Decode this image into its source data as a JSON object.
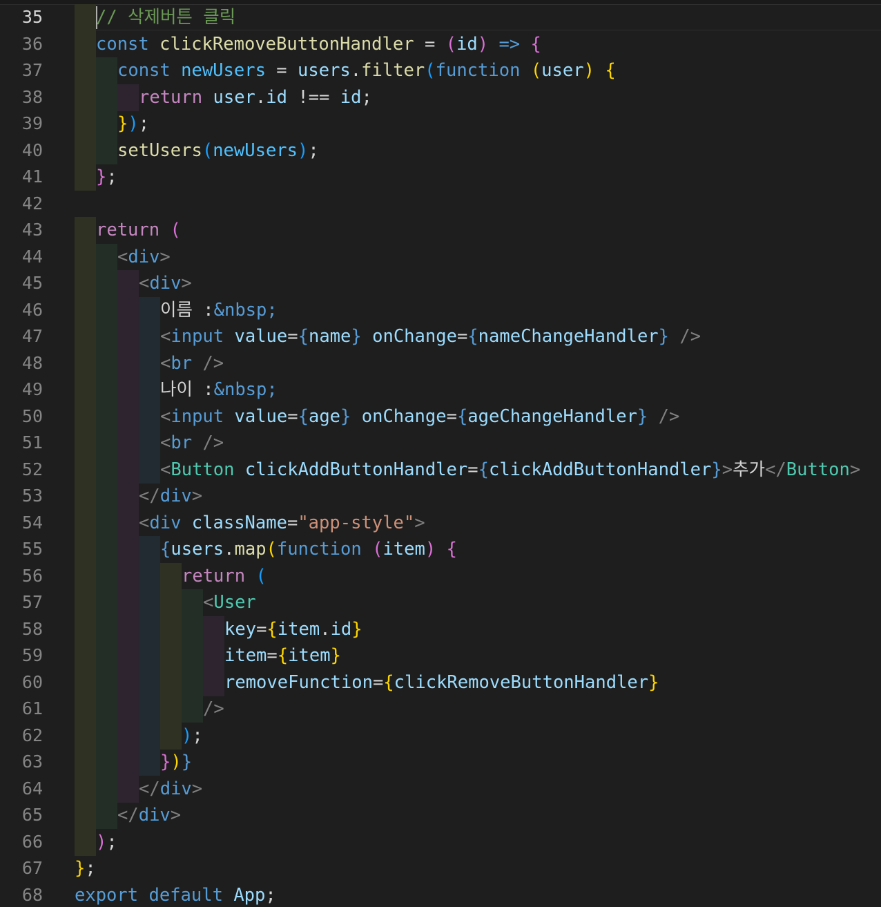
{
  "editor": {
    "language": "javascript-react",
    "active_line": 35,
    "colors": {
      "background": "#1e1e1e",
      "keyword": "#569cd6",
      "control": "#c586c0",
      "function": "#dcdcaa",
      "variable": "#9cdcfe",
      "comment": "#6a9955",
      "string": "#ce9178",
      "component": "#4ec9b0",
      "bracket_1": "#ffd700",
      "bracket_2": "#da70d6",
      "bracket_3": "#179fff"
    }
  },
  "line_numbers": [
    "35",
    "36",
    "37",
    "38",
    "39",
    "40",
    "41",
    "42",
    "43",
    "44",
    "45",
    "46",
    "47",
    "48",
    "49",
    "50",
    "51",
    "52",
    "53",
    "54",
    "55",
    "56",
    "57",
    "58",
    "59",
    "60",
    "61",
    "62",
    "63",
    "64",
    "65",
    "66",
    "67",
    "68"
  ],
  "code": [
    [
      [
        "cm",
        "// 삭제버튼 클릭"
      ]
    ],
    [
      [
        "kw",
        "const"
      ],
      [
        "txt",
        " "
      ],
      [
        "fn",
        "clickRemoveButtonHandler"
      ],
      [
        "txt",
        " = "
      ],
      [
        "b2",
        "("
      ],
      [
        "var",
        "id"
      ],
      [
        "b2",
        ")"
      ],
      [
        "txt",
        " "
      ],
      [
        "kw",
        "=>"
      ],
      [
        "txt",
        " "
      ],
      [
        "b2",
        "{"
      ]
    ],
    [
      [
        "kw",
        "const"
      ],
      [
        "txt",
        " "
      ],
      [
        "const",
        "newUsers"
      ],
      [
        "txt",
        " = "
      ],
      [
        "var",
        "users"
      ],
      [
        "txt",
        "."
      ],
      [
        "fn",
        "filter"
      ],
      [
        "b3",
        "("
      ],
      [
        "kw",
        "function"
      ],
      [
        "txt",
        " "
      ],
      [
        "b1",
        "("
      ],
      [
        "var",
        "user"
      ],
      [
        "b1",
        ")"
      ],
      [
        "txt",
        " "
      ],
      [
        "b1",
        "{"
      ]
    ],
    [
      [
        "ctl",
        "return"
      ],
      [
        "txt",
        " "
      ],
      [
        "var",
        "user"
      ],
      [
        "txt",
        "."
      ],
      [
        "var",
        "id"
      ],
      [
        "txt",
        " !== "
      ],
      [
        "var",
        "id"
      ],
      [
        "txt",
        ";"
      ]
    ],
    [
      [
        "b1",
        "}"
      ],
      [
        "b3",
        ")"
      ],
      [
        "txt",
        ";"
      ]
    ],
    [
      [
        "fn",
        "setUsers"
      ],
      [
        "b3",
        "("
      ],
      [
        "const",
        "newUsers"
      ],
      [
        "b3",
        ")"
      ],
      [
        "txt",
        ";"
      ]
    ],
    [
      [
        "b2",
        "}"
      ],
      [
        "txt",
        ";"
      ]
    ],
    [],
    [
      [
        "ctl",
        "return"
      ],
      [
        "txt",
        " "
      ],
      [
        "b2",
        "("
      ]
    ],
    [
      [
        "punct",
        "<"
      ],
      [
        "tag",
        "div"
      ],
      [
        "punct",
        ">"
      ]
    ],
    [
      [
        "punct",
        "<"
      ],
      [
        "tag",
        "div"
      ],
      [
        "punct",
        ">"
      ]
    ],
    [
      [
        "txt",
        "이름 :"
      ],
      [
        "ent",
        "&nbsp;"
      ]
    ],
    [
      [
        "punct",
        "<"
      ],
      [
        "tag",
        "input"
      ],
      [
        "txt",
        " "
      ],
      [
        "var",
        "value"
      ],
      [
        "txt",
        "="
      ],
      [
        "kw",
        "{"
      ],
      [
        "var",
        "name"
      ],
      [
        "kw",
        "}"
      ],
      [
        "txt",
        " "
      ],
      [
        "var",
        "onChange"
      ],
      [
        "txt",
        "="
      ],
      [
        "kw",
        "{"
      ],
      [
        "var",
        "nameChangeHandler"
      ],
      [
        "kw",
        "}"
      ],
      [
        "txt",
        " "
      ],
      [
        "punct",
        "/>"
      ]
    ],
    [
      [
        "punct",
        "<"
      ],
      [
        "tag",
        "br"
      ],
      [
        "txt",
        " "
      ],
      [
        "punct",
        "/>"
      ]
    ],
    [
      [
        "txt",
        "나이 :"
      ],
      [
        "ent",
        "&nbsp;"
      ]
    ],
    [
      [
        "punct",
        "<"
      ],
      [
        "tag",
        "input"
      ],
      [
        "txt",
        " "
      ],
      [
        "var",
        "value"
      ],
      [
        "txt",
        "="
      ],
      [
        "kw",
        "{"
      ],
      [
        "var",
        "age"
      ],
      [
        "kw",
        "}"
      ],
      [
        "txt",
        " "
      ],
      [
        "var",
        "onChange"
      ],
      [
        "txt",
        "="
      ],
      [
        "kw",
        "{"
      ],
      [
        "var",
        "ageChangeHandler"
      ],
      [
        "kw",
        "}"
      ],
      [
        "txt",
        " "
      ],
      [
        "punct",
        "/>"
      ]
    ],
    [
      [
        "punct",
        "<"
      ],
      [
        "tag",
        "br"
      ],
      [
        "txt",
        " "
      ],
      [
        "punct",
        "/>"
      ]
    ],
    [
      [
        "punct",
        "<"
      ],
      [
        "comp",
        "Button"
      ],
      [
        "txt",
        " "
      ],
      [
        "var",
        "clickAddButtonHandler"
      ],
      [
        "txt",
        "="
      ],
      [
        "kw",
        "{"
      ],
      [
        "var",
        "clickAddButtonHandler"
      ],
      [
        "kw",
        "}"
      ],
      [
        "punct",
        ">"
      ],
      [
        "txt",
        "추가"
      ],
      [
        "punct",
        "</"
      ],
      [
        "comp",
        "Button"
      ],
      [
        "punct",
        ">"
      ]
    ],
    [
      [
        "punct",
        "</"
      ],
      [
        "tag",
        "div"
      ],
      [
        "punct",
        ">"
      ]
    ],
    [
      [
        "punct",
        "<"
      ],
      [
        "tag",
        "div"
      ],
      [
        "txt",
        " "
      ],
      [
        "var",
        "className"
      ],
      [
        "txt",
        "="
      ],
      [
        "str",
        "\"app-style\""
      ],
      [
        "punct",
        ">"
      ]
    ],
    [
      [
        "kw",
        "{"
      ],
      [
        "var",
        "users"
      ],
      [
        "txt",
        "."
      ],
      [
        "fn",
        "map"
      ],
      [
        "b1",
        "("
      ],
      [
        "kw",
        "function"
      ],
      [
        "txt",
        " "
      ],
      [
        "b2",
        "("
      ],
      [
        "var",
        "item"
      ],
      [
        "b2",
        ")"
      ],
      [
        "txt",
        " "
      ],
      [
        "b2",
        "{"
      ]
    ],
    [
      [
        "ctl",
        "return"
      ],
      [
        "txt",
        " "
      ],
      [
        "b3",
        "("
      ]
    ],
    [
      [
        "punct",
        "<"
      ],
      [
        "comp",
        "User"
      ]
    ],
    [
      [
        "var",
        "key"
      ],
      [
        "txt",
        "="
      ],
      [
        "b1",
        "{"
      ],
      [
        "var",
        "item"
      ],
      [
        "txt",
        "."
      ],
      [
        "var",
        "id"
      ],
      [
        "b1",
        "}"
      ]
    ],
    [
      [
        "var",
        "item"
      ],
      [
        "txt",
        "="
      ],
      [
        "b1",
        "{"
      ],
      [
        "var",
        "item"
      ],
      [
        "b1",
        "}"
      ]
    ],
    [
      [
        "var",
        "removeFunction"
      ],
      [
        "txt",
        "="
      ],
      [
        "b1",
        "{"
      ],
      [
        "var",
        "clickRemoveButtonHandler"
      ],
      [
        "b1",
        "}"
      ]
    ],
    [
      [
        "punct",
        "/>"
      ]
    ],
    [
      [
        "b3",
        ")"
      ],
      [
        "txt",
        ";"
      ]
    ],
    [
      [
        "b2",
        "}"
      ],
      [
        "b1",
        ")"
      ],
      [
        "kw",
        "}"
      ]
    ],
    [
      [
        "punct",
        "</"
      ],
      [
        "tag",
        "div"
      ],
      [
        "punct",
        ">"
      ]
    ],
    [
      [
        "punct",
        "</"
      ],
      [
        "tag",
        "div"
      ],
      [
        "punct",
        ">"
      ]
    ],
    [
      [
        "b2",
        ")"
      ],
      [
        "txt",
        ";"
      ]
    ],
    [
      [
        "b1",
        "}"
      ],
      [
        "txt",
        ";"
      ]
    ],
    [
      [
        "kw",
        "export"
      ],
      [
        "txt",
        " "
      ],
      [
        "kw",
        "default"
      ],
      [
        "txt",
        " "
      ],
      [
        "var",
        "App"
      ],
      [
        "txt",
        ";"
      ]
    ]
  ]
}
